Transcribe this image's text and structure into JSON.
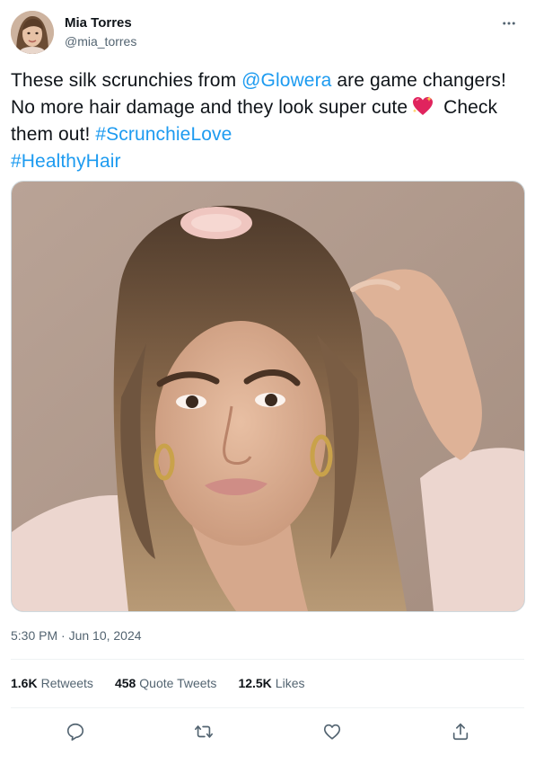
{
  "author": {
    "display_name": "Mia Torres",
    "handle": "@mia_torres"
  },
  "tweet": {
    "text_part1": "These silk scrunchies from ",
    "mention": "@Glowera",
    "text_part2": " are game changers! No more hair damage and they look super cute",
    "emoji_name": "sparkling-heart",
    "text_part3": " Check them out! ",
    "hashtag1": "#ScrunchieLove",
    "hashtag2": "#HealthyHair"
  },
  "timestamp": "5:30 PM · Jun 10, 2024",
  "stats": {
    "retweets_count": "1.6K",
    "retweets_label": "Retweets",
    "quotes_count": "458",
    "quotes_label": "Quote Tweets",
    "likes_count": "12.5K",
    "likes_label": "Likes"
  },
  "actions": {
    "reply_icon": "reply-icon",
    "retweet_icon": "retweet-icon",
    "like_icon": "heart-icon",
    "share_icon": "share-icon"
  },
  "colors": {
    "link": "#1d9bf0",
    "muted": "#536471",
    "text": "#0f1419"
  }
}
